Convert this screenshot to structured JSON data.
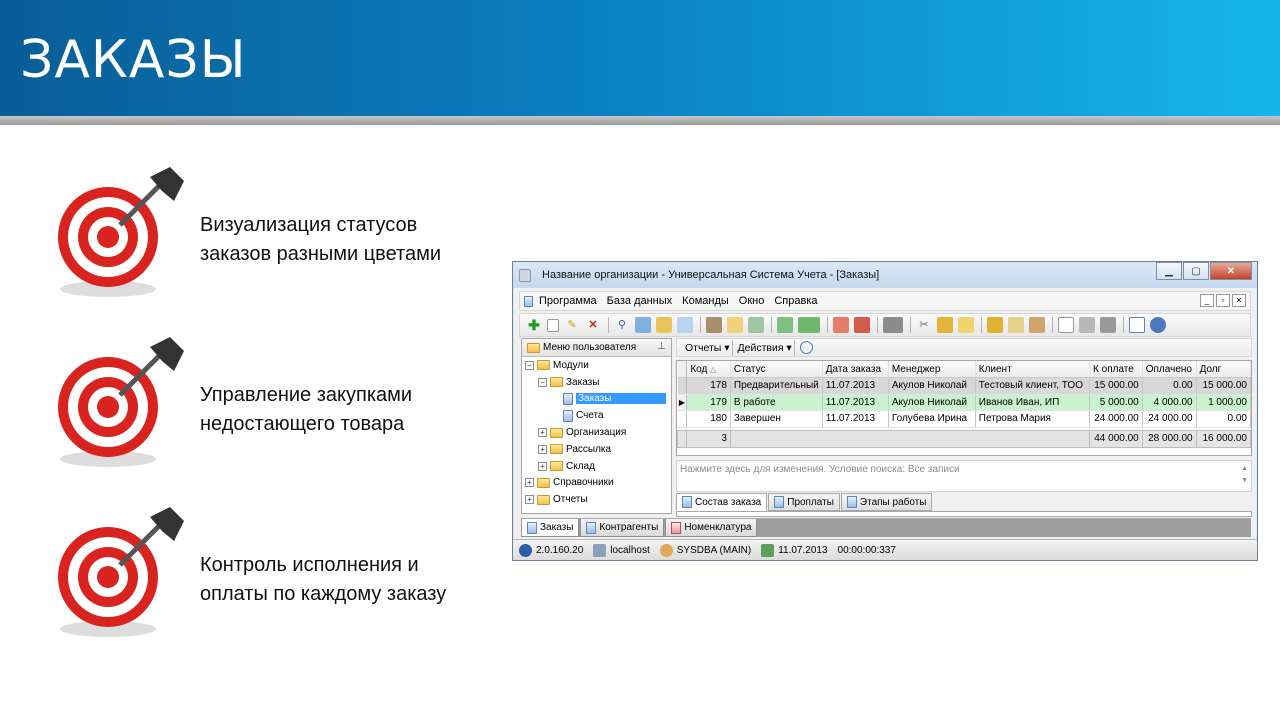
{
  "slide": {
    "title": "ЗАКАЗЫ"
  },
  "bullets": [
    {
      "line1": "Визуализация статусов",
      "line2": "заказов разными цветами"
    },
    {
      "line1": "Управление закупками",
      "line2": "недостающего товара"
    },
    {
      "line1": "Контроль исполнения и",
      "line2": "оплаты по каждому заказу"
    }
  ],
  "window": {
    "title": "Название организации - Универсальная Система Учета - [Заказы]",
    "menu": [
      "Программа",
      "База данных",
      "Команды",
      "Окно",
      "Справка"
    ],
    "left_panel": {
      "header": "Меню пользователя",
      "tree": {
        "modules": "Модули",
        "orders": "Заказы",
        "orders_sel": "Заказы",
        "invoices": "Счета",
        "organization": "Организация",
        "mailing": "Рассылка",
        "warehouse": "Склад",
        "references": "Справочники",
        "reports": "Отчеты"
      }
    },
    "right_toolbar": {
      "reports": "Отчеты",
      "actions": "Действия"
    },
    "grid": {
      "columns": [
        "Код",
        "Статус",
        "Дата заказа",
        "Менеджер",
        "Клиент",
        "К оплате",
        "Оплачено",
        "Долг"
      ],
      "rows": [
        {
          "code": "178",
          "status": "Предварительный",
          "date": "11.07.2013",
          "manager": "Акулов Николай",
          "client": "Тестовый клиент, ТОО",
          "to_pay": "15 000.00",
          "paid": "0.00",
          "debt": "15 000.00"
        },
        {
          "code": "179",
          "status": "В работе",
          "date": "11.07.2013",
          "manager": "Акулов Николай",
          "client": "Иванов Иван, ИП",
          "to_pay": "5 000.00",
          "paid": "4 000.00",
          "debt": "1 000.00"
        },
        {
          "code": "180",
          "status": "Завершен",
          "date": "11.07.2013",
          "manager": "Голубева Ирина",
          "client": "Петрова Мария",
          "to_pay": "24 000.00",
          "paid": "24 000.00",
          "debt": "0.00"
        }
      ],
      "totals": {
        "count": "3",
        "to_pay": "44 000.00",
        "paid": "28 000.00",
        "debt": "16 000.00"
      },
      "row_colors": {
        "preliminary": "#d8d8d8",
        "in_work": "#c9f3cc",
        "done": "#ffffff"
      }
    },
    "filter_text": "Нажмите здесь для изменения. Условие поиска: Все записи",
    "detail_tabs": [
      "Состав заказа",
      "Проплаты",
      "Этапы работы"
    ],
    "bottom_tabs": [
      "Заказы",
      "Контрагенты",
      "Номенклатура"
    ],
    "status": {
      "version": "2.0.160.20",
      "host": "localhost",
      "user": "SYSDBA (MAIN)",
      "date": "11.07.2013",
      "time": "00:00:00:337"
    }
  }
}
